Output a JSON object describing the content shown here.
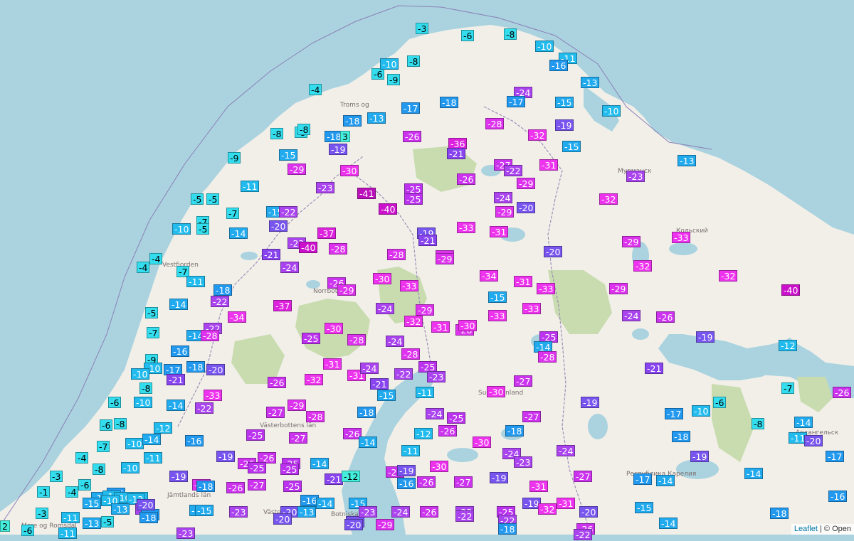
{
  "map": {
    "colors": {
      "sea": "#aad3df",
      "land": "#f2efe9",
      "forest": "#c8dcb0",
      "lake": "#aad3df",
      "border": "#9e8fb8",
      "road": "#f0c89a"
    },
    "attribution": {
      "leaflet": "Leaflet",
      "separator": " | © Open"
    },
    "places": [
      "Troms og",
      "Vestfjorden",
      "Norrbotten",
      "Västerbottens län",
      "Jämtlands län",
      "Västerbotten",
      "Botniska viken",
      "Suomi Finland",
      "Мурманск",
      "Кольский",
      "Республика Карелия",
      "Архангельск",
      "Møre og Romsdal"
    ],
    "stations": [
      {
        "t": "-3",
        "c": "#33ddee"
      },
      {
        "t": "-6",
        "c": "#33ddee"
      },
      {
        "t": "-8",
        "c": "#33ddee"
      },
      {
        "t": "-8",
        "c": "#33ddee"
      },
      {
        "t": "-10",
        "c": "#22bbee"
      },
      {
        "t": "-11",
        "c": "#22bbee"
      },
      {
        "t": "-16",
        "c": "#2299ee"
      },
      {
        "t": "-13",
        "c": "#22aaee"
      },
      {
        "t": "-10",
        "c": "#22bbee"
      },
      {
        "t": "-8",
        "c": "#33ddee"
      },
      {
        "t": "-6",
        "c": "#33ddee"
      },
      {
        "t": "-9",
        "c": "#33ddee"
      },
      {
        "t": "-4",
        "c": "#33ddee"
      },
      {
        "t": "-17",
        "c": "#2299ee"
      },
      {
        "t": "-18",
        "c": "#2299ee"
      },
      {
        "t": "-24",
        "c": "#aa44ee"
      },
      {
        "t": "-17",
        "c": "#2299ee"
      },
      {
        "t": "-15",
        "c": "#22aaee"
      },
      {
        "t": "-10",
        "c": "#22bbee"
      },
      {
        "t": "-13",
        "c": "#22aaee"
      },
      {
        "t": "-18",
        "c": "#2299ee"
      },
      {
        "t": "-8",
        "c": "#33ddee"
      },
      {
        "t": "-8",
        "c": "#33ddee"
      },
      {
        "t": "-18",
        "c": "#2299ee"
      },
      {
        "t": "3",
        "c": "#44eedd"
      },
      {
        "t": "-26",
        "c": "#cc33ee"
      },
      {
        "t": "-28",
        "c": "#dd33ee"
      },
      {
        "t": "-32",
        "c": "#ee33ee"
      },
      {
        "t": "-19",
        "c": "#7755ee"
      },
      {
        "t": "-36",
        "c": "#dd22dd"
      },
      {
        "t": "-15",
        "c": "#22aaee"
      },
      {
        "t": "-9",
        "c": "#33ddee"
      },
      {
        "t": "-15",
        "c": "#22aaee"
      },
      {
        "t": "-19",
        "c": "#7755ee"
      },
      {
        "t": "-21",
        "c": "#8844ee"
      },
      {
        "t": "-29",
        "c": "#dd33ee"
      },
      {
        "t": "-30",
        "c": "#ee33ee"
      },
      {
        "t": "-27",
        "c": "#cc33ee"
      },
      {
        "t": "-22",
        "c": "#aa44ee"
      },
      {
        "t": "-31",
        "c": "#ee33ee"
      },
      {
        "t": "-13",
        "c": "#22aaee"
      },
      {
        "t": "-11",
        "c": "#22bbee"
      },
      {
        "t": "-23",
        "c": "#aa44ee"
      },
      {
        "t": "-41",
        "c": "#bb11bb"
      },
      {
        "t": "-25",
        "c": "#bb33ee"
      },
      {
        "t": "-26",
        "c": "#cc33ee"
      },
      {
        "t": "-24",
        "c": "#aa44ee"
      },
      {
        "t": "-25",
        "c": "#bb33ee"
      },
      {
        "t": "-29",
        "c": "#dd33ee"
      },
      {
        "t": "-23",
        "c": "#aa44ee"
      },
      {
        "t": "-32",
        "c": "#ee33ee"
      },
      {
        "t": "-5",
        "c": "#33ddee"
      },
      {
        "t": "-5",
        "c": "#33ddee"
      },
      {
        "t": "-7",
        "c": "#33ddee"
      },
      {
        "t": "-5",
        "c": "#33ddee"
      },
      {
        "t": "-10",
        "c": "#22bbee"
      },
      {
        "t": "-7",
        "c": "#33ddee"
      },
      {
        "t": "-15",
        "c": "#22aaee"
      },
      {
        "t": "-22",
        "c": "#aa44ee"
      },
      {
        "t": "-40",
        "c": "#cc11cc"
      },
      {
        "t": "-29",
        "c": "#dd33ee"
      },
      {
        "t": "-20",
        "c": "#7755ee"
      },
      {
        "t": "-14",
        "c": "#22aaee"
      },
      {
        "t": "-20",
        "c": "#7755ee"
      },
      {
        "t": "-37",
        "c": "#dd22dd"
      },
      {
        "t": "-19",
        "c": "#7755ee"
      },
      {
        "t": "-33",
        "c": "#ee33ee"
      },
      {
        "t": "-31",
        "c": "#ee33ee"
      },
      {
        "t": "-21",
        "c": "#8844ee"
      },
      {
        "t": "-33",
        "c": "#ee33ee"
      },
      {
        "t": "-21",
        "c": "#8844ee"
      },
      {
        "t": "-22",
        "c": "#aa44ee"
      },
      {
        "t": "-40",
        "c": "#cc11cc"
      },
      {
        "t": "-28",
        "c": "#dd33ee"
      },
      {
        "t": "-28",
        "c": "#dd33ee"
      },
      {
        "t": "-29",
        "c": "#dd33ee"
      },
      {
        "t": "-29",
        "c": "#dd33ee"
      },
      {
        "t": "-20",
        "c": "#7755ee"
      },
      {
        "t": "-29",
        "c": "#dd33ee"
      },
      {
        "t": "-4",
        "c": "#33ddee"
      },
      {
        "t": "-4",
        "c": "#33ddee"
      },
      {
        "t": "-7",
        "c": "#33ddee"
      },
      {
        "t": "-24",
        "c": "#aa44ee"
      },
      {
        "t": "-30",
        "c": "#ee33ee"
      },
      {
        "t": "-34",
        "c": "#ee33ee"
      },
      {
        "t": "-31",
        "c": "#ee33ee"
      },
      {
        "t": "-32",
        "c": "#ee33ee"
      },
      {
        "t": "-32",
        "c": "#ee33ee"
      },
      {
        "t": "-40",
        "c": "#cc11cc"
      },
      {
        "t": "-11",
        "c": "#22bbee"
      },
      {
        "t": "-18",
        "c": "#2299ee"
      },
      {
        "t": "-26",
        "c": "#cc33ee"
      },
      {
        "t": "-29",
        "c": "#dd33ee"
      },
      {
        "t": "-33",
        "c": "#ee33ee"
      },
      {
        "t": "-15",
        "c": "#22aaee"
      },
      {
        "t": "-33",
        "c": "#ee33ee"
      },
      {
        "t": "-29",
        "c": "#dd33ee"
      },
      {
        "t": "-14",
        "c": "#22aaee"
      },
      {
        "t": "-22",
        "c": "#aa44ee"
      },
      {
        "t": "-34",
        "c": "#ee33ee"
      },
      {
        "t": "-37",
        "c": "#dd22dd"
      },
      {
        "t": "-24",
        "c": "#aa44ee"
      },
      {
        "t": "-29",
        "c": "#dd33ee"
      },
      {
        "t": "-33",
        "c": "#ee33ee"
      },
      {
        "t": "-33",
        "c": "#ee33ee"
      },
      {
        "t": "-24",
        "c": "#aa44ee"
      },
      {
        "t": "-26",
        "c": "#cc33ee"
      },
      {
        "t": "-5",
        "c": "#33ddee"
      },
      {
        "t": "-7",
        "c": "#33ddee"
      },
      {
        "t": "-14",
        "c": "#22aaee"
      },
      {
        "t": "-22",
        "c": "#aa44ee"
      },
      {
        "t": "-25",
        "c": "#bb33ee"
      },
      {
        "t": "-30",
        "c": "#ee33ee"
      },
      {
        "t": "-32",
        "c": "#ee33ee"
      },
      {
        "t": "-31",
        "c": "#ee33ee"
      },
      {
        "t": "-28",
        "c": "#dd33ee"
      },
      {
        "t": "-30",
        "c": "#ee33ee"
      },
      {
        "t": "-25",
        "c": "#bb33ee"
      },
      {
        "t": "-19",
        "c": "#7755ee"
      },
      {
        "t": "-12",
        "c": "#22bbee"
      },
      {
        "t": "-16",
        "c": "#2299ee"
      },
      {
        "t": "-28",
        "c": "#dd33ee"
      },
      {
        "t": "-28",
        "c": "#dd33ee"
      },
      {
        "t": "-14",
        "c": "#22aaee"
      },
      {
        "t": "-24",
        "c": "#aa44ee"
      },
      {
        "t": "-28",
        "c": "#dd33ee"
      },
      {
        "t": "-28",
        "c": "#dd33ee"
      },
      {
        "t": "-9",
        "c": "#33ddee"
      },
      {
        "t": "-10",
        "c": "#22bbee"
      },
      {
        "t": "-10",
        "c": "#22bbee"
      },
      {
        "t": "-17",
        "c": "#2299ee"
      },
      {
        "t": "-21",
        "c": "#8844ee"
      },
      {
        "t": "-18",
        "c": "#2299ee"
      },
      {
        "t": "-20",
        "c": "#7755ee"
      },
      {
        "t": "-31",
        "c": "#ee33ee"
      },
      {
        "t": "-31",
        "c": "#ee33ee"
      },
      {
        "t": "-24",
        "c": "#aa44ee"
      },
      {
        "t": "-21",
        "c": "#8844ee"
      },
      {
        "t": "-22",
        "c": "#aa44ee"
      },
      {
        "t": "-25",
        "c": "#bb33ee"
      },
      {
        "t": "-23",
        "c": "#aa44ee"
      },
      {
        "t": "-27",
        "c": "#cc33ee"
      },
      {
        "t": "-21",
        "c": "#8844ee"
      },
      {
        "t": "-8",
        "c": "#33ddee"
      },
      {
        "t": "-26",
        "c": "#cc33ee"
      },
      {
        "t": "-32",
        "c": "#ee33ee"
      },
      {
        "t": "-15",
        "c": "#22aaee"
      },
      {
        "t": "-11",
        "c": "#22bbee"
      },
      {
        "t": "-30",
        "c": "#ee33ee"
      },
      {
        "t": "-7",
        "c": "#33ddee"
      },
      {
        "t": "-26",
        "c": "#cc33ee"
      },
      {
        "t": "-6",
        "c": "#33ddee"
      },
      {
        "t": "-10",
        "c": "#22bbee"
      },
      {
        "t": "-14",
        "c": "#22aaee"
      },
      {
        "t": "-22",
        "c": "#aa44ee"
      },
      {
        "t": "-33",
        "c": "#ee33ee"
      },
      {
        "t": "-27",
        "c": "#cc33ee"
      },
      {
        "t": "-29",
        "c": "#dd33ee"
      },
      {
        "t": "-18",
        "c": "#2299ee"
      },
      {
        "t": "-24",
        "c": "#aa44ee"
      },
      {
        "t": "-25",
        "c": "#bb33ee"
      },
      {
        "t": "-27",
        "c": "#cc33ee"
      },
      {
        "t": "-19",
        "c": "#7755ee"
      },
      {
        "t": "-17",
        "c": "#2299ee"
      },
      {
        "t": "-10",
        "c": "#22bbee"
      },
      {
        "t": "-6",
        "c": "#33ddee"
      },
      {
        "t": "-6",
        "c": "#33ddee"
      },
      {
        "t": "-8",
        "c": "#33ddee"
      },
      {
        "t": "-12",
        "c": "#22bbee"
      },
      {
        "t": "-28",
        "c": "#dd33ee"
      },
      {
        "t": "-26",
        "c": "#cc33ee"
      },
      {
        "t": "-12",
        "c": "#22bbee"
      },
      {
        "t": "-26",
        "c": "#cc33ee"
      },
      {
        "t": "-18",
        "c": "#2299ee"
      },
      {
        "t": "-18",
        "c": "#2299ee"
      },
      {
        "t": "-8",
        "c": "#33ddee"
      },
      {
        "t": "-14",
        "c": "#22aaee"
      },
      {
        "t": "-11",
        "c": "#22bbee"
      },
      {
        "t": "-20",
        "c": "#7755ee"
      },
      {
        "t": "-17",
        "c": "#2299ee"
      },
      {
        "t": "-7",
        "c": "#33ddee"
      },
      {
        "t": "-10",
        "c": "#22bbee"
      },
      {
        "t": "-14",
        "c": "#22aaee"
      },
      {
        "t": "-16",
        "c": "#2299ee"
      },
      {
        "t": "-25",
        "c": "#bb33ee"
      },
      {
        "t": "-27",
        "c": "#cc33ee"
      },
      {
        "t": "-14",
        "c": "#22aaee"
      },
      {
        "t": "-30",
        "c": "#ee33ee"
      },
      {
        "t": "-11",
        "c": "#22bbee"
      },
      {
        "t": "-24",
        "c": "#aa44ee"
      },
      {
        "t": "-4",
        "c": "#33ddee"
      },
      {
        "t": "-11",
        "c": "#22bbee"
      },
      {
        "t": "-19",
        "c": "#7755ee"
      },
      {
        "t": "-26",
        "c": "#cc33ee"
      },
      {
        "t": "-25",
        "c": "#bb33ee"
      },
      {
        "t": "-26",
        "c": "#cc33ee"
      },
      {
        "t": "-24",
        "c": "#aa44ee"
      },
      {
        "t": "-23",
        "c": "#aa44ee"
      },
      {
        "t": "-19",
        "c": "#7755ee"
      },
      {
        "t": "-8",
        "c": "#33ddee"
      },
      {
        "t": "-10",
        "c": "#22bbee"
      },
      {
        "t": "-25",
        "c": "#bb33ee"
      },
      {
        "t": "-25",
        "c": "#bb33ee"
      },
      {
        "t": "-14",
        "c": "#22aaee"
      },
      {
        "t": "-30",
        "c": "#ee33ee"
      },
      {
        "t": "-14",
        "c": "#22aaee"
      },
      {
        "t": "-3",
        "c": "#33ddee"
      },
      {
        "t": "-6",
        "c": "#33ddee"
      },
      {
        "t": "-13",
        "c": "#22aaee"
      },
      {
        "t": "-16",
        "c": "#2299ee"
      },
      {
        "t": "-12",
        "c": "#22bbee"
      },
      {
        "t": "-29",
        "c": "#dd33ee"
      },
      {
        "t": "-26",
        "c": "#cc33ee"
      },
      {
        "t": "-27",
        "c": "#cc33ee"
      },
      {
        "t": "-19",
        "c": "#7755ee"
      },
      {
        "t": "-27",
        "c": "#cc33ee"
      },
      {
        "t": "-17",
        "c": "#2299ee"
      },
      {
        "t": "-1",
        "c": "#33ddee"
      },
      {
        "t": "-4",
        "c": "#33ddee"
      },
      {
        "t": "-10",
        "c": "#22bbee"
      },
      {
        "t": "-10",
        "c": "#22bbee"
      },
      {
        "t": "-12",
        "c": "#22bbee"
      },
      {
        "t": "-19",
        "c": "#7755ee"
      },
      {
        "t": "-18",
        "c": "#2299ee"
      },
      {
        "t": "-27",
        "c": "#cc33ee"
      },
      {
        "t": "-25",
        "c": "#bb33ee"
      },
      {
        "t": "-21",
        "c": "#8844ee"
      },
      {
        "t": "-12",
        "c": "#44eedd"
      },
      {
        "t": "-15",
        "c": "#22aaee"
      },
      {
        "t": "-10",
        "c": "#22bbee"
      },
      {
        "t": "-22",
        "c": "#aa44ee"
      },
      {
        "t": "-18",
        "c": "#2299ee"
      },
      {
        "t": "-16",
        "c": "#2299ee"
      },
      {
        "t": "-15",
        "c": "#22aaee"
      },
      {
        "t": "-16",
        "c": "#2299ee"
      },
      {
        "t": "-26",
        "c": "#cc33ee"
      },
      {
        "t": "-27",
        "c": "#cc33ee"
      },
      {
        "t": "-19",
        "c": "#7755ee"
      },
      {
        "t": "-31",
        "c": "#ee33ee"
      },
      {
        "t": "-14",
        "c": "#22aaee"
      },
      {
        "t": "-13",
        "c": "#22aaee"
      },
      {
        "t": "-20",
        "c": "#7755ee"
      },
      {
        "t": "-13",
        "c": "#22aaee"
      },
      {
        "t": "-15",
        "c": "#22aaee"
      },
      {
        "t": "-23",
        "c": "#aa44ee"
      },
      {
        "t": "-20",
        "c": "#7755ee"
      },
      {
        "t": "-13",
        "c": "#22aaee"
      },
      {
        "t": "-14",
        "c": "#22aaee"
      },
      {
        "t": "-20",
        "c": "#7755ee"
      },
      {
        "t": "-23",
        "c": "#aa44ee"
      },
      {
        "t": "-24",
        "c": "#aa44ee"
      },
      {
        "t": "-26",
        "c": "#cc33ee"
      },
      {
        "t": "-22",
        "c": "#aa44ee"
      },
      {
        "t": "-25",
        "c": "#bb33ee"
      },
      {
        "t": "-19",
        "c": "#7755ee"
      },
      {
        "t": "-32",
        "c": "#ee33ee"
      },
      {
        "t": "-31",
        "c": "#ee33ee"
      },
      {
        "t": "-20",
        "c": "#7755ee"
      },
      {
        "t": "-15",
        "c": "#22aaee"
      },
      {
        "t": "-14",
        "c": "#22aaee"
      },
      {
        "t": "-18",
        "c": "#2299ee"
      },
      {
        "t": "-16",
        "c": "#2299ee"
      },
      {
        "t": "-11",
        "c": "#22bbee"
      },
      {
        "t": "-3",
        "c": "#33ddee"
      },
      {
        "t": "-13",
        "c": "#22aaee"
      },
      {
        "t": "-5",
        "c": "#33ddee"
      },
      {
        "t": "-18",
        "c": "#2299ee"
      },
      {
        "t": "-20",
        "c": "#7755ee"
      },
      {
        "t": "-29",
        "c": "#dd33ee"
      },
      {
        "t": "-20",
        "c": "#7755ee"
      },
      {
        "t": "-22",
        "c": "#aa44ee"
      },
      {
        "t": "-22",
        "c": "#aa44ee"
      },
      {
        "t": "-18",
        "c": "#2299ee"
      },
      {
        "t": "-26",
        "c": "#cc33ee"
      },
      {
        "t": "2",
        "c": "#44eedd"
      },
      {
        "t": "-6",
        "c": "#33ddee"
      },
      {
        "t": "-11",
        "c": "#22bbee"
      },
      {
        "t": "-23",
        "c": "#aa44ee"
      },
      {
        "t": "-22",
        "c": "#aa44ee"
      }
    ]
  }
}
